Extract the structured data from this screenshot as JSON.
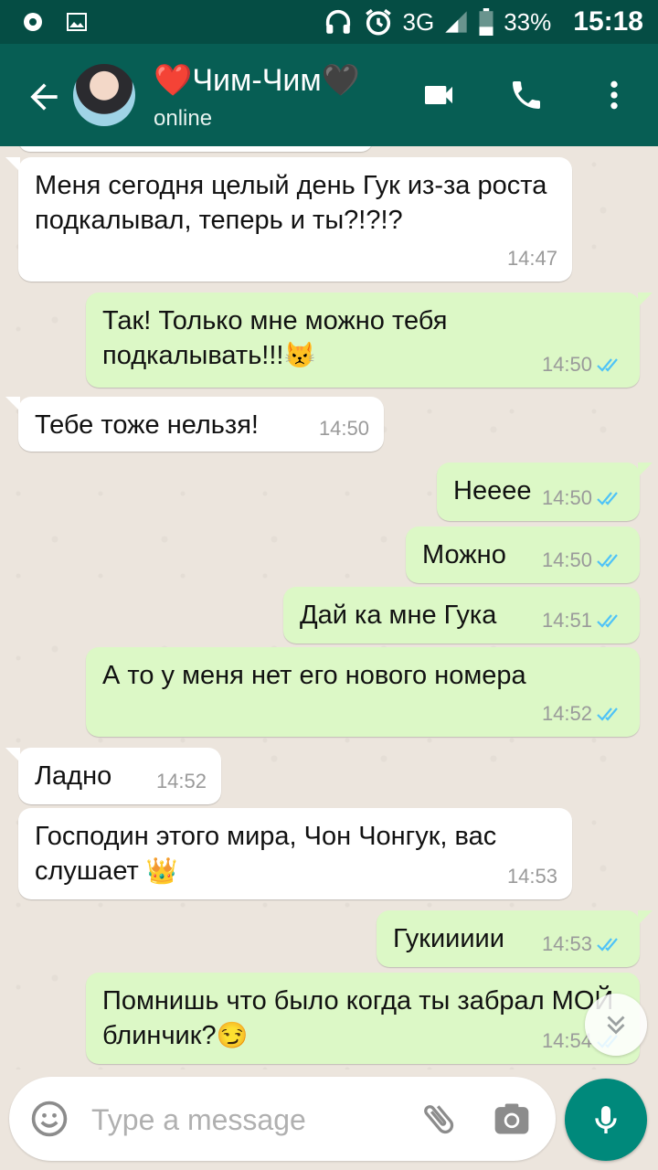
{
  "status_bar": {
    "network": "3G",
    "battery": "33%",
    "time": "15:18",
    "icons": [
      "notification-dot-icon",
      "image-icon",
      "headphones-icon",
      "alarm-icon",
      "signal-icon",
      "battery-icon"
    ]
  },
  "header": {
    "name_prefix_emoji": "❤️",
    "name": "Чим-Чим",
    "name_suffix_emoji": "🖤",
    "status": "online",
    "icons": [
      "back-arrow-icon",
      "video-call-icon",
      "phone-icon",
      "more-vert-icon"
    ]
  },
  "messages": [
    {
      "dir": "in",
      "text": "Меня сегодня целый день Гук из-за роста подкалывал, теперь и ты?!?!?",
      "time": "14:47"
    },
    {
      "dir": "out",
      "text": "Так! Только мне можно тебя подкалывать!!!",
      "emoji": "😾",
      "time": "14:50",
      "status": "read"
    },
    {
      "dir": "in",
      "text": "Тебе тоже нельзя!",
      "time": "14:50"
    },
    {
      "dir": "out",
      "text": "Нееее",
      "time": "14:50",
      "status": "read"
    },
    {
      "dir": "out",
      "text": "Можно",
      "time": "14:50",
      "status": "read"
    },
    {
      "dir": "out",
      "text": "Дай ка мне Гука",
      "time": "14:51",
      "status": "read"
    },
    {
      "dir": "out",
      "text": "А то у меня нет его нового номера",
      "time": "14:52",
      "status": "read"
    },
    {
      "dir": "in",
      "text": "Ладно",
      "time": "14:52"
    },
    {
      "dir": "in",
      "text": "Господин этого мира, Чон Чонгук, вас слушает",
      "emoji": "👑",
      "time": "14:53"
    },
    {
      "dir": "out",
      "text": "Гукиииии",
      "time": "14:53",
      "status": "read"
    },
    {
      "dir": "out",
      "text": "Помнишь что было когда ты забрал МОЙ блинчик?",
      "emoji": "😏",
      "time": "14:54",
      "status": "read"
    }
  ],
  "input": {
    "placeholder": "Type a message",
    "icons": [
      "emoji-icon",
      "attach-icon",
      "camera-icon",
      "mic-icon"
    ]
  },
  "colors": {
    "header": "#075E54",
    "status_bar": "#054D44",
    "outgoing_bubble": "#DCF8C6",
    "incoming_bubble": "#FFFFFF",
    "read_ticks": "#4FC3F7",
    "mic_button": "#00897B"
  }
}
